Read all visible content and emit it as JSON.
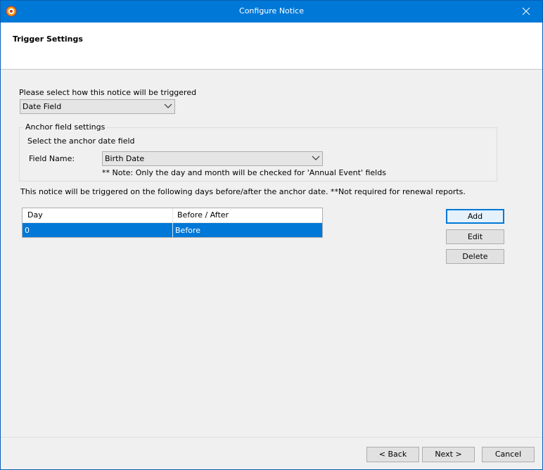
{
  "window": {
    "title": "Configure Notice"
  },
  "header": {
    "title": "Trigger Settings"
  },
  "trigger": {
    "prompt": "Please select how this notice will be triggered",
    "selected": "Date Field"
  },
  "anchor": {
    "group_label": "Anchor field settings",
    "instruction": "Select the anchor date field",
    "field_label": "Field Name:",
    "field_value": "Birth Date",
    "note": "** Note: Only the day and month will be checked for 'Annual Event' fields"
  },
  "days": {
    "description": "This notice will be triggered on the following days before/after the anchor date. **Not required for renewal reports.",
    "columns": [
      "Day",
      "Before / After"
    ],
    "rows": [
      [
        "0",
        "Before"
      ]
    ]
  },
  "actions": {
    "add": "Add",
    "edit": "Edit",
    "delete": "Delete"
  },
  "footer": {
    "back": "< Back",
    "next": "Next >",
    "cancel": "Cancel"
  },
  "colors": {
    "titlebar": "#0078d7",
    "selection": "#0078d7"
  }
}
